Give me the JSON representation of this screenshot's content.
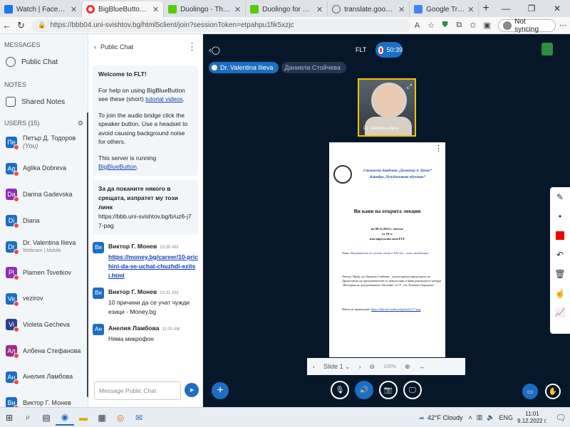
{
  "browser": {
    "tabs": [
      {
        "title": "Watch | Facebook",
        "color": "#1877f2"
      },
      {
        "title": "BigBlueButton - FLT",
        "color": "#e33",
        "active": true
      },
      {
        "title": "Duolingo - The world's best",
        "color": "#58cc02"
      },
      {
        "title": "Duolingo for Schools",
        "color": "#58cc02"
      },
      {
        "title": "translate.google.com - Search",
        "color": "#888"
      },
      {
        "title": "Google Translate",
        "color": "#4285f4"
      }
    ],
    "url": "https://bbb04.uni-svishtov.bg/html5client/join?sessionToken=etpahpu1fik5xzjc",
    "sync_label": "Not syncing"
  },
  "sidebar": {
    "messages_header": "MESSAGES",
    "public_chat": "Public Chat",
    "notes_header": "NOTES",
    "shared_notes": "Shared Notes",
    "users_header": "USERS (15)",
    "users": [
      {
        "initials": "Пе",
        "name": "Петър Д. Тодоров",
        "suffix": "(You)",
        "color": "#1b6ec2"
      },
      {
        "initials": "Ag",
        "name": "Aglika Dobreva",
        "color": "#1b6ec2"
      },
      {
        "initials": "Da",
        "name": "Darina Gadevska",
        "color": "#8e2fb5"
      },
      {
        "initials": "Di",
        "name": "Diana",
        "color": "#1b6ec2"
      },
      {
        "initials": "Dr",
        "name": "Dr. Valentina Ilieva",
        "sub": "Webcam | Mobile",
        "color": "#1b6ec2"
      },
      {
        "initials": "Pl",
        "name": "Plamen Tsvetkov",
        "color": "#8e2fb5"
      },
      {
        "initials": "Ve",
        "name": "vezirov",
        "color": "#1b6ec2"
      },
      {
        "initials": "Vi",
        "name": "Violeta Gecheva",
        "color": "#2e3d8f"
      },
      {
        "initials": "Ал",
        "name": "Албена Стефанова",
        "color": "#a32a8a"
      },
      {
        "initials": "Ан",
        "name": "Анелия Ламбова",
        "color": "#1b6ec2"
      },
      {
        "initials": "Ви",
        "name": "Виктор Г. Монев",
        "color": "#1b6ec2"
      }
    ]
  },
  "chat": {
    "title": "Public Chat",
    "welcome_heading": "Welcome to FLT!",
    "welcome_p1_pre": "For help on using BigBlueButton see these (short) ",
    "welcome_p1_link": "tutorial videos",
    "welcome_p1_post": ".",
    "welcome_p2": "To join the audio bridge click the speaker button. Use a headset to avoid causing background noise for others.",
    "welcome_p3_pre": "This server is running ",
    "welcome_p3_link": "BigBlueButton",
    "welcome_p3_post": ".",
    "invite_text": "За да поканите някого в срещата, изпратет му този линк",
    "invite_link": "https://bbb.uni-svishtov.bg/b/uz6-j77-pag",
    "messages": [
      {
        "initials": "Ви",
        "name": "Виктор Г. Монев",
        "time": "10:30 AM",
        "link": "https://money.bg/career/10-prichini-da-se-uchat-chuzhdi-ezitsi.html"
      },
      {
        "initials": "Ви",
        "name": "Виктор Г. Монев",
        "time": "10:31 AM",
        "text": "10 причини да се учат чужди езици - Money.bg"
      },
      {
        "initials": "Ан",
        "name": "Анелия Ламбова",
        "time": "11:00 AM",
        "text": "Няма микрофон"
      }
    ],
    "input_placeholder": "Message Public Chat"
  },
  "meeting": {
    "title": "FLT",
    "recording_time": "50:39",
    "talkers": [
      {
        "name": "Dr. Valentina Ilieva",
        "color": "#1b6ec2"
      },
      {
        "name": "Даниела Стойчева",
        "color": "#23364f"
      }
    ],
    "video_name": "Dr. Valentina Ilieva"
  },
  "slide": {
    "header_line1": "Стопанска Академия „Димитър А. Ценов“",
    "header_line2": "Катедра „Чуждоезиково обучение“",
    "title": "Ви кани на открита лекция",
    "when": "на 09.12.2022 г. /петък/",
    "time": "от 10 ч.",
    "place": "във виртуална зала FLT",
    "topic_label": "Тема:",
    "topic": "Изучаването на чужди езици в XXI век – нови тенденции",
    "body": "Лектор: Проф. д-р Даниела Стойчева – дългогодишен председател на Дружеството на преподавателите по немски език и бивш ръководител катедра „Методика на чуждоезиковото обучение“ в СУ „Св. Климент Охридски“",
    "link_label": "Място на провеждане:",
    "link": "https://bbb.uni-svishtov.bg/b/uz6-j77-pag",
    "nav_label": "Slide 1",
    "zoom": "100%"
  },
  "taskbar": {
    "weather": "42°F  Cloudy",
    "lang": "ENG",
    "time": "11:01",
    "date": "9.12.2022 г."
  }
}
